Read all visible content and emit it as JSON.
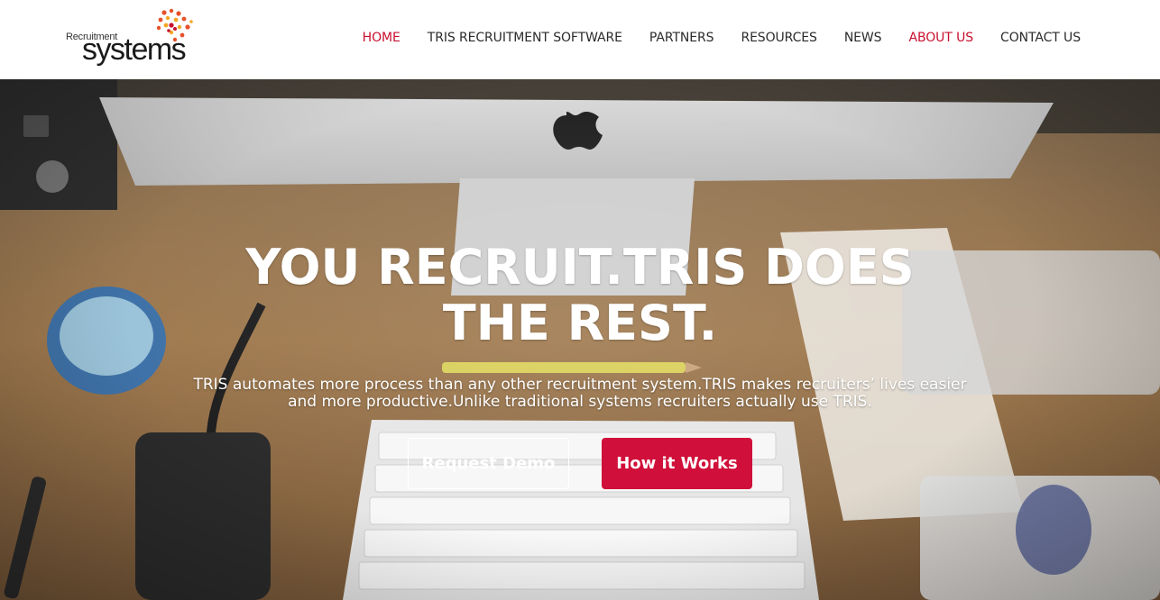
{
  "logo": {
    "small_text": "Recruitment",
    "big_text": "systems"
  },
  "nav": {
    "items": [
      {
        "label": "HOME",
        "active": true
      },
      {
        "label": "TRIS RECRUITMENT SOFTWARE",
        "active": false
      },
      {
        "label": "PARTNERS",
        "active": false
      },
      {
        "label": "RESOURCES",
        "active": false
      },
      {
        "label": "NEWS",
        "active": false
      },
      {
        "label": "ABOUT US",
        "active": true
      },
      {
        "label": "CONTACT US",
        "active": false
      }
    ]
  },
  "hero": {
    "title": "YOU RECRUIT.TRIS DOES THE REST.",
    "subtitle": "TRIS automates more process than any other recruitment system.TRIS makes recruiters’ lives easier and more productive.Unlike traditional systems recruiters actually use TRIS.",
    "buttons": {
      "request_demo": "Request Demo",
      "how_it_works": "How it Works"
    }
  },
  "colors": {
    "accent": "#c8102e",
    "button_solid": "#d0103a",
    "nav_text": "#2b2b2b"
  }
}
